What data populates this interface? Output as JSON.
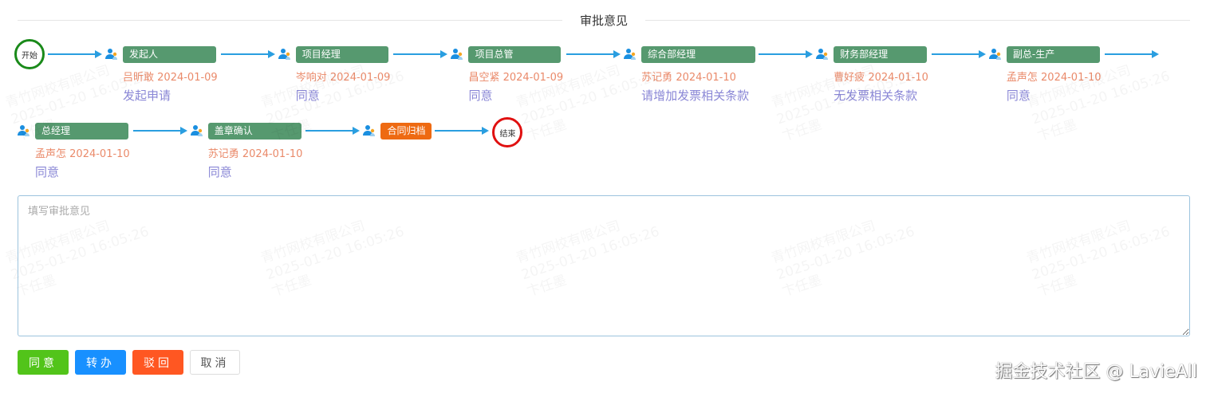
{
  "header": {
    "title": "审批意见"
  },
  "flow": {
    "start_label": "开始",
    "end_label": "结束",
    "row1": [
      {
        "role": "发起人",
        "approver": "吕昕敢",
        "date": "2024-01-09",
        "opinion": "发起申请"
      },
      {
        "role": "项目经理",
        "approver": "岑响对",
        "date": "2024-01-09",
        "opinion": "同意"
      },
      {
        "role": "项目总管",
        "approver": "昌空紧",
        "date": "2024-01-09",
        "opinion": "同意"
      },
      {
        "role": "综合部经理",
        "approver": "苏记勇",
        "date": "2024-01-10",
        "opinion": "请增加发票相关条款"
      },
      {
        "role": "财务部经理",
        "approver": "曹好疲",
        "date": "2024-01-10",
        "opinion": "无发票相关条款"
      },
      {
        "role": "副总-生产",
        "approver": "孟声怎",
        "date": "2024-01-10",
        "opinion": "同意"
      }
    ],
    "row2": [
      {
        "role": "总经理",
        "approver": "孟声怎",
        "date": "2024-01-10",
        "opinion": "同意"
      },
      {
        "role": "盖章确认",
        "approver": "苏记勇",
        "date": "2024-01-10",
        "opinion": "同意"
      },
      {
        "role": "合同归档",
        "current": true
      }
    ]
  },
  "comment": {
    "placeholder": "填写审批意见",
    "value": ""
  },
  "buttons": {
    "agree": "同意",
    "transfer": "转办",
    "reject": "驳回",
    "cancel": "取消"
  },
  "watermark": {
    "line1": "青竹网校有限公司",
    "line2": "2025-01-20 16:05:26",
    "line3": "卞任墨"
  },
  "credit": "掘金技术社区 @ LavieAll",
  "colors": {
    "node": "#56996f",
    "current": "#ee6a12",
    "agree": "#52c41a",
    "transfer": "#1890ff",
    "reject": "#ff5722"
  }
}
